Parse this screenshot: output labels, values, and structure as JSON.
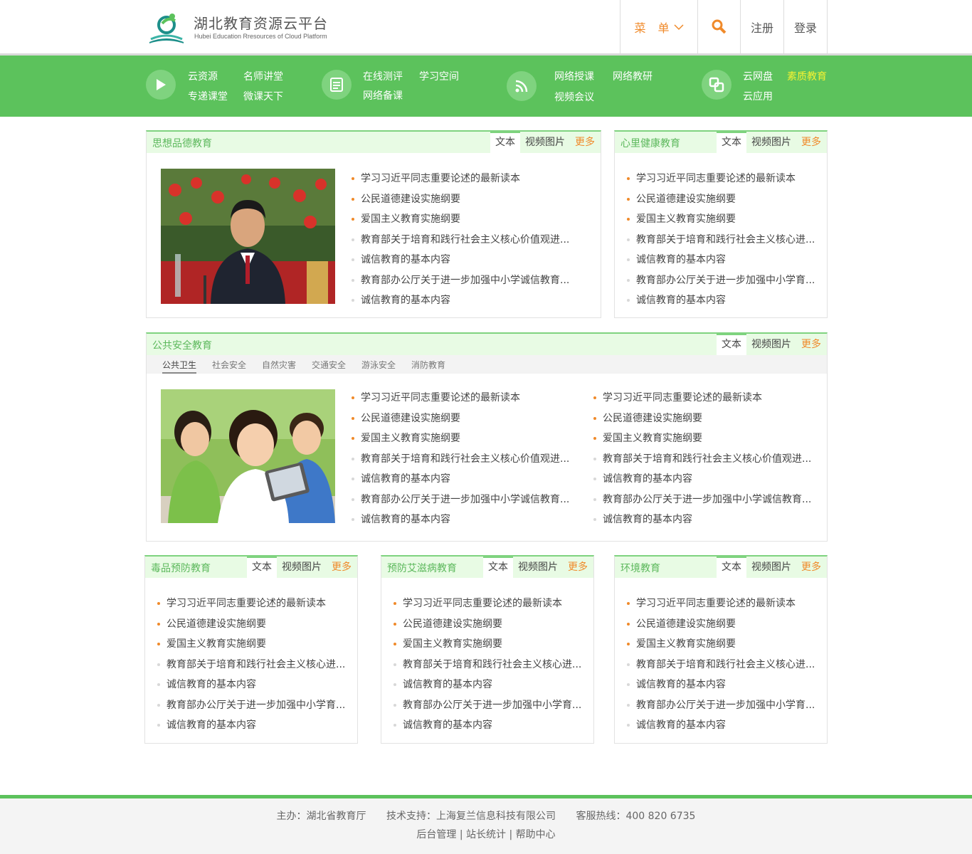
{
  "header": {
    "logo_title": "湖北教育资源云平台",
    "logo_subtitle": "Hubei Education Rresources of Cloud Platform",
    "menu_label": "菜 单",
    "register_label": "注册",
    "login_label": "登录"
  },
  "nav": {
    "group1": [
      "云资源",
      "名师讲堂",
      "专递课堂",
      "微课天下"
    ],
    "group2": [
      "在线测评",
      "学习空间",
      "网络备课"
    ],
    "group3": [
      "网络授课",
      "网络教研",
      "视频会议"
    ],
    "group4": [
      "云网盘",
      "素质教育",
      "云应用"
    ]
  },
  "common_tabs": {
    "text": "文本",
    "video": "视频图片",
    "more": "更多"
  },
  "panels": {
    "moral": {
      "title": "思想品德教育"
    },
    "mental": {
      "title": "心里健康教育"
    },
    "safety": {
      "title": "公共安全教育",
      "subtabs": [
        "公共卫生",
        "社会安全",
        "自然灾害",
        "交通安全",
        "游泳安全",
        "消防教育"
      ]
    },
    "drug": {
      "title": "毒品预防教育"
    },
    "aids": {
      "title": "预防艾滋病教育"
    },
    "env": {
      "title": "环境教育"
    }
  },
  "articles_long": [
    "学习习近平同志重要论述的最新读本",
    "公民道德建设实施纲要",
    "爱国主义教育实施纲要",
    "教育部关于培育和践行社会主义核心价值观进...",
    "诚信教育的基本内容",
    "教育部办公厅关于进一步加强中小学诚信教育...",
    "诚信教育的基本内容"
  ],
  "articles_safety_right": [
    "学习习近平同志重要论述的最新读本",
    "公民道德建设实施纲要",
    "爱国主义教育实施纲要",
    "教育部关于培育和践行社会主义核心价值观进...",
    "诚信教育的基本内容",
    "教育部办公厅关于进一步加强中小学诚信教育...",
    "诚信教育的基本内容"
  ],
  "articles_short": [
    "学习习近平同志重要论述的最新读本",
    "公民道德建设实施纲要",
    "爱国主义教育实施纲要",
    "教育部关于培育和践行社会主义核心进...",
    "诚信教育的基本内容",
    "教育部办公厅关于进一步加强中小学育...",
    "诚信教育的基本内容"
  ],
  "footer": {
    "host": "主办：湖北省教育厅",
    "support": "技术支持：上海复兰信息科技有限公司",
    "hotline": "客服热线：400 820 6735",
    "links": "后台管理 | 站长统计 | 帮助中心"
  },
  "colors": {
    "green": "#5cc25c",
    "light_green": "#e8fbe4",
    "orange": "#f08a2a",
    "yellow": "#f5f232"
  },
  "icons": [
    "logo-icon",
    "chevron-down-icon",
    "search-icon",
    "play-icon",
    "document-icon",
    "rss-icon",
    "cloud-box-icon"
  ]
}
